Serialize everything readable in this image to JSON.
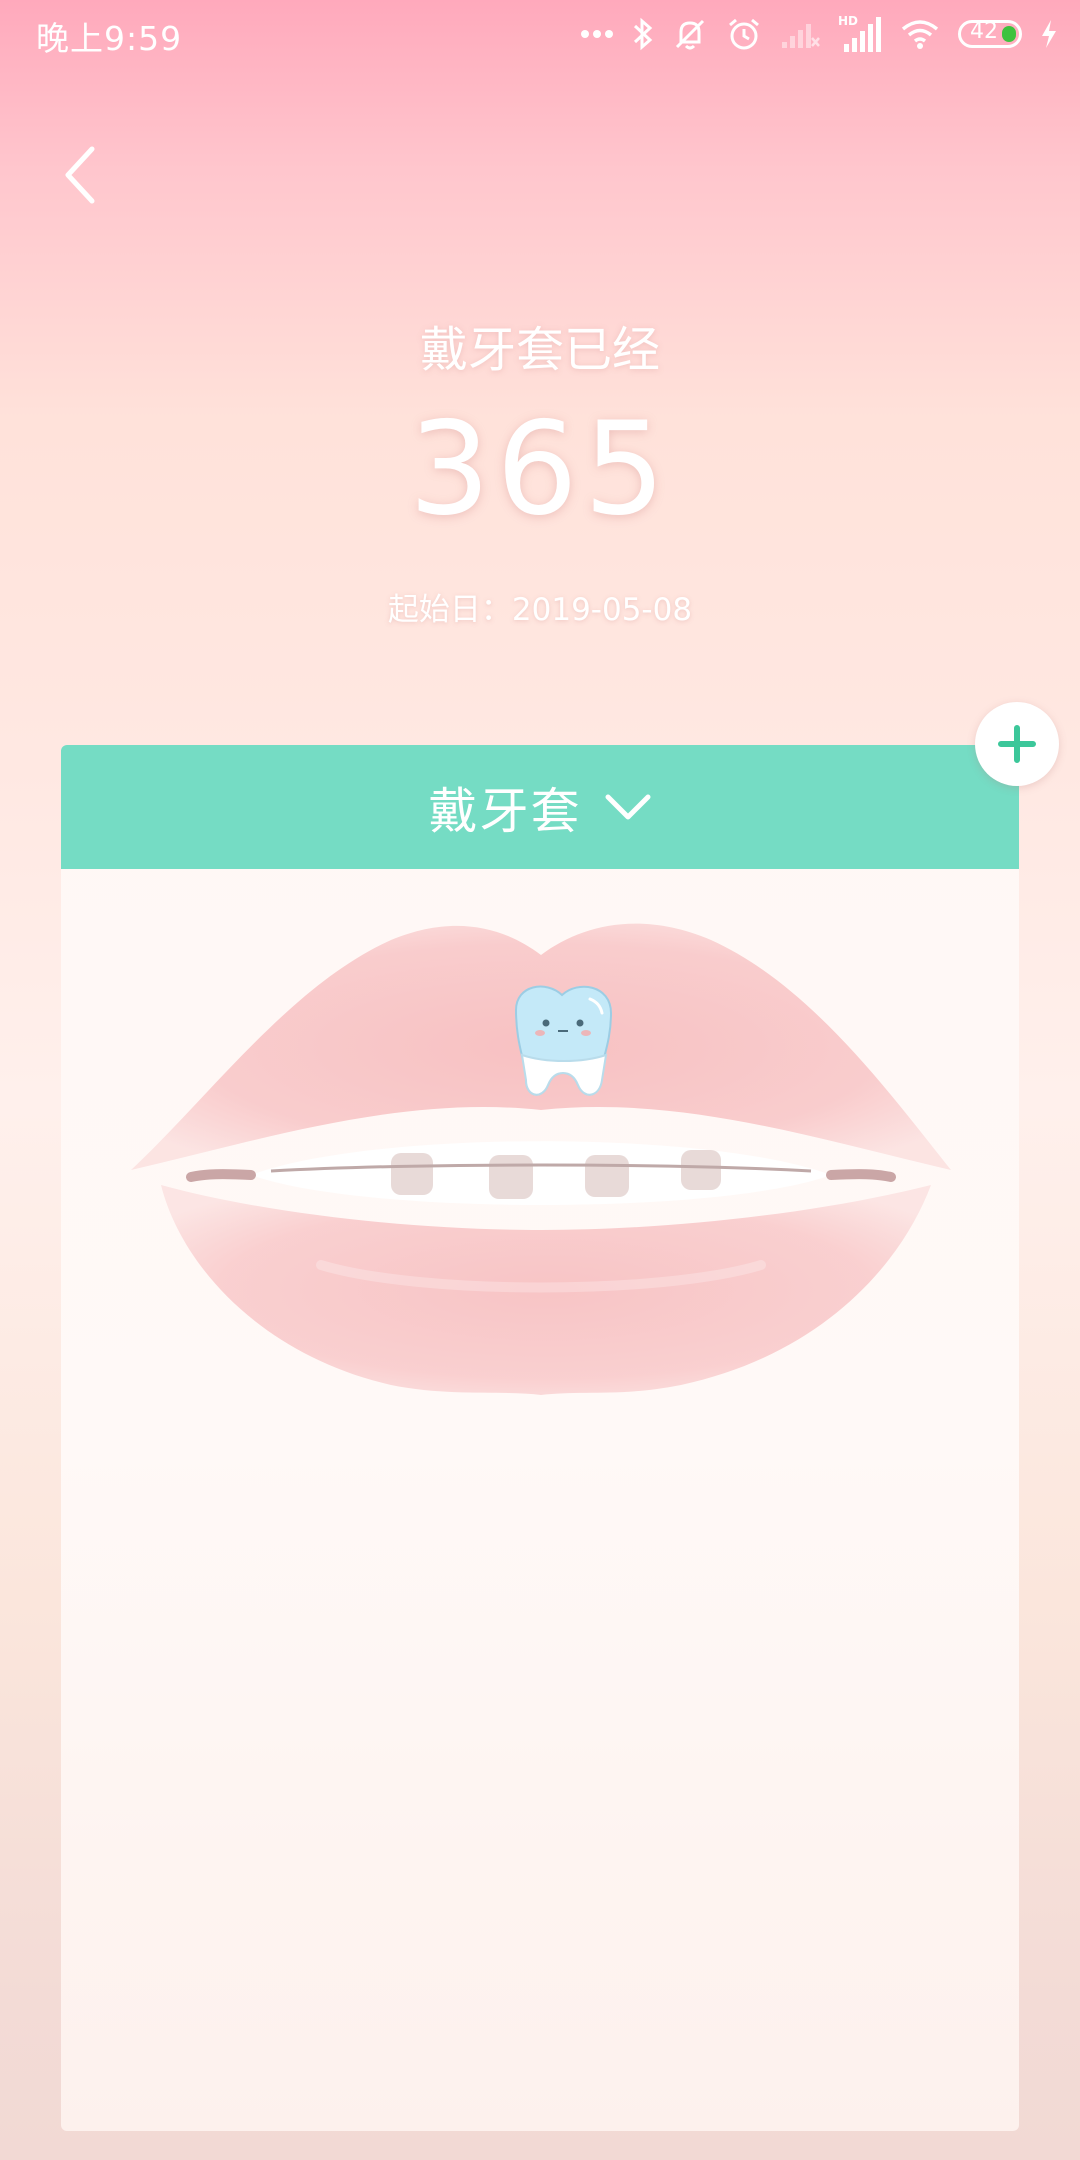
{
  "status_bar": {
    "time": "晚上9:59",
    "battery_level": "42",
    "icons": [
      "more-dots-icon",
      "bluetooth-icon",
      "mute-icon",
      "alarm-icon",
      "signal-weak-icon",
      "hd-signal-icon",
      "wifi-icon",
      "battery-icon",
      "charging-icon"
    ]
  },
  "header": {
    "back_icon": "chevron-left-icon"
  },
  "counter": {
    "label": "戴牙套已经",
    "value": "365",
    "start_date": "起始日：2019-05-08"
  },
  "card": {
    "title": "戴牙套",
    "dropdown_icon": "chevron-down-icon",
    "illustration": "lips-with-braces-and-tooth-mascot"
  },
  "add_button": {
    "icon": "plus-icon"
  },
  "colors": {
    "accent": "#75dcc4",
    "plus": "#3cc79a",
    "battery": "#3ec23e"
  }
}
